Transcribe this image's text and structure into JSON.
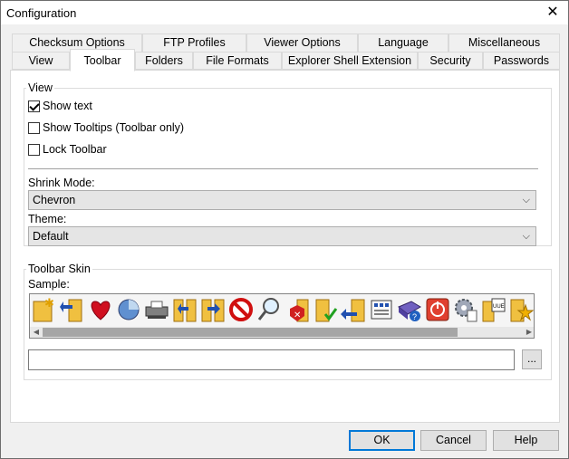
{
  "window": {
    "title": "Configuration",
    "close_glyph": "✕"
  },
  "tabs": {
    "row1": [
      "Checksum Options",
      "FTP Profiles",
      "Viewer Options",
      "Language",
      "Miscellaneous"
    ],
    "row2": [
      "View",
      "Toolbar",
      "Folders",
      "File Formats",
      "Explorer Shell Extension",
      "Security",
      "Passwords"
    ],
    "active": "Toolbar"
  },
  "view_group": {
    "title": "View",
    "show_text": {
      "label": "Show text",
      "checked": true
    },
    "show_tooltips": {
      "label": "Show Tooltips (Toolbar only)",
      "checked": false
    },
    "lock_toolbar": {
      "label": "Lock Toolbar",
      "checked": false
    },
    "shrink_mode": {
      "label": "Shrink Mode:",
      "value": "Chevron"
    },
    "theme": {
      "label": "Theme:",
      "value": "Default"
    }
  },
  "skin_group": {
    "title": "Toolbar Skin",
    "sample_label": "Sample:",
    "path_value": "",
    "browse_label": "...",
    "icons": [
      "new-folder-icon",
      "open-folder-icon",
      "favorites-heart-icon",
      "statistics-pie-icon",
      "scanner-icon",
      "copy-to-folder-icon",
      "move-to-folder-icon",
      "stop-icon",
      "find-icon",
      "delete-icon",
      "checksum-verify-icon",
      "rename-icon",
      "properties-icon",
      "book-help-icon",
      "power-icon",
      "settings-icon",
      "view-uue-icon",
      "favorite-star-icon",
      "mail-icon"
    ]
  },
  "buttons": {
    "ok": "OK",
    "cancel": "Cancel",
    "help": "Help"
  },
  "colors": {
    "accent": "#0078d7",
    "panel": "#ffffff",
    "dialog": "#f0f0f0"
  }
}
